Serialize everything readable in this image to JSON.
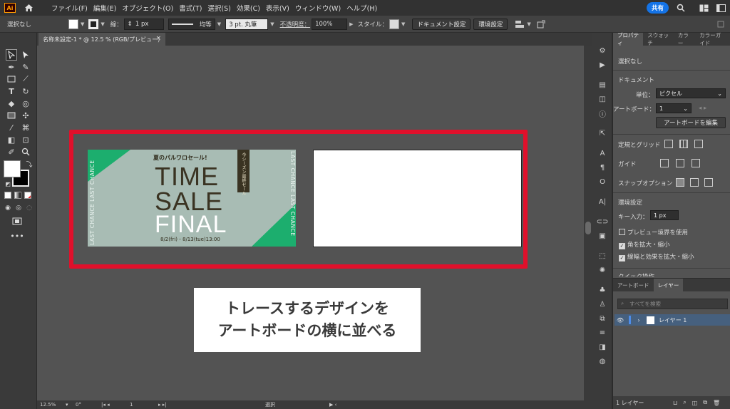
{
  "app": {
    "logo": "Ai"
  },
  "menu": [
    "ファイル(F)",
    "編集(E)",
    "オブジェクト(O)",
    "書式(T)",
    "選択(S)",
    "効果(C)",
    "表示(V)",
    "ウィンドウ(W)",
    "ヘルプ(H)"
  ],
  "menu_right": {
    "share": "共有"
  },
  "control": {
    "selection": "選択なし",
    "stroke_label": "線：",
    "stroke_value": "1 px",
    "stroke_style": "均等",
    "brush": "3 pt. 丸筆",
    "opacity_label": "不透明度：",
    "opacity_value": "100%",
    "style_label": "スタイル：",
    "doc_settings": "ドキュメント設定",
    "preferences": "環境設定"
  },
  "tab": {
    "title": "名称未設定-1 * @ 12.5 % (RGB/プレビュー)",
    "close": "×"
  },
  "artboard1": {
    "headline": "夏のパルワロセール!",
    "word1": "TIME",
    "word2": "SALE",
    "word3": "FINAL",
    "dates": "8/2(fri) - 8/13(tue)13:00",
    "ribbon": "今シーズン最終セール",
    "side_text": "LAST CHANCE LAST CHANCE"
  },
  "note": {
    "line1": "トレースするデザインを",
    "line2": "アートボードの横に並べる"
  },
  "status": {
    "zoom": "12.5%",
    "angle": "0°",
    "artboard": "1",
    "tool": "選択"
  },
  "properties": {
    "tabs": [
      "プロパティ",
      "スウォッチ",
      "カラー",
      "カラーガイド"
    ],
    "selection": "選択なし",
    "document": "ドキュメント",
    "units_label": "単位：",
    "units_value": "ピクセル",
    "artboard_label": "アートボード：",
    "artboard_value": "1",
    "edit_artboard": "アートボードを編集",
    "rulers": "定規とグリッド",
    "guides": "ガイド",
    "snap": "スナップオプション",
    "prefs": "環境設定",
    "key_label": "キー入力：",
    "key_value": "1 px",
    "cb_preview": "プレビュー境界を使用",
    "cb_corners": "角を拡大・縮小",
    "cb_strokes": "線幅と効果を拡大・縮小",
    "quick_actions": "クイック操作"
  },
  "layers": {
    "tabs": [
      "アートボード",
      "レイヤー"
    ],
    "search": "すべてを検索",
    "layer_name": "レイヤー 1",
    "footer": "1 レイヤー"
  },
  "colors": {
    "frame": "#e0102b",
    "accent_green": "#1cae6e",
    "artboard_bg": "#a8bcb4",
    "share": "#1473e6"
  }
}
